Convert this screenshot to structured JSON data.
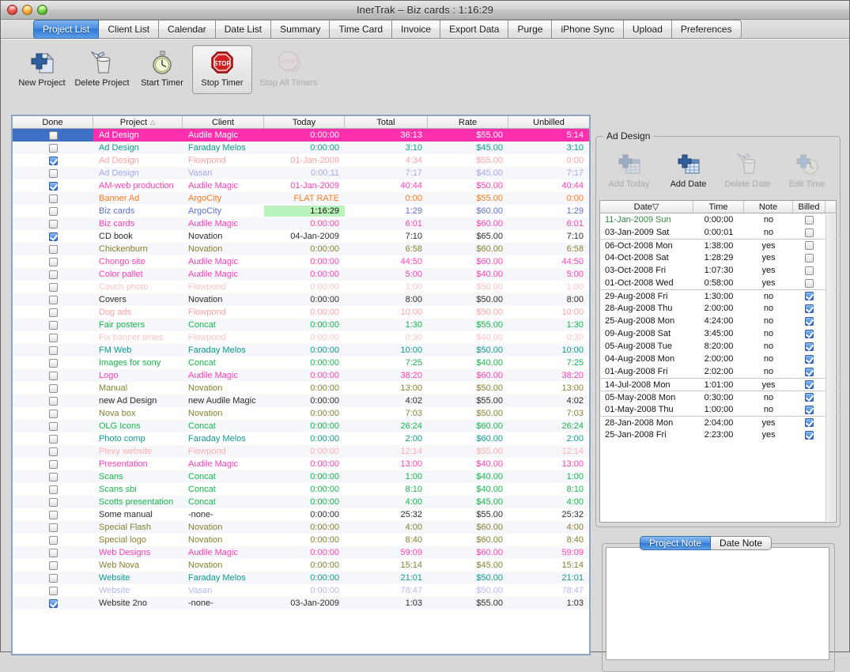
{
  "window": {
    "title": "InerTrak – Biz cards : 1:16:29"
  },
  "tabs": [
    {
      "label": "Project List",
      "active": true
    },
    {
      "label": "Client List",
      "active": false
    },
    {
      "label": "Calendar",
      "active": false
    },
    {
      "label": "Date List",
      "active": false
    },
    {
      "label": "Summary",
      "active": false
    },
    {
      "label": "Time Card",
      "active": false
    },
    {
      "label": "Invoice",
      "active": false
    },
    {
      "label": "Export Data",
      "active": false
    },
    {
      "label": "Purge",
      "active": false
    },
    {
      "label": "iPhone Sync",
      "active": false
    },
    {
      "label": "Upload",
      "active": false
    },
    {
      "label": "Preferences",
      "active": false
    }
  ],
  "toolbar": [
    {
      "label": "New Project",
      "icon": "new-document-plus-icon",
      "state": "normal"
    },
    {
      "label": "Delete Project",
      "icon": "trash-can-icon",
      "state": "normal"
    },
    {
      "label": "Start Timer",
      "icon": "stopwatch-icon",
      "state": "normal"
    },
    {
      "label": "Stop Timer",
      "icon": "stop-sign-icon",
      "state": "pressed"
    },
    {
      "label": "Stop All Timers",
      "icon": "stop-sign-stack-icon",
      "state": "disabled"
    }
  ],
  "project_table": {
    "columns": [
      "Done",
      "Project",
      "Client",
      "Today",
      "Total",
      "Rate",
      "Unbilled"
    ],
    "sorted_column": "Project",
    "sort_direction": "asc",
    "rows": [
      {
        "done": false,
        "selected": true,
        "project": "Ad Design",
        "client": "Audile Magic",
        "today": "0:00:00",
        "total": "36:13",
        "rate": "$55.00",
        "unbilled": "5:14",
        "color": "#ff2fae"
      },
      {
        "done": false,
        "selected": false,
        "project": "Ad Design",
        "client": "Faraday Melos",
        "today": "0:00:00",
        "total": "3:10",
        "rate": "$45.00",
        "unbilled": "3:10",
        "color": "#0e9b8e"
      },
      {
        "done": true,
        "selected": false,
        "project": "Ad Design",
        "client": "Flowpond",
        "today": "01-Jan-2009",
        "total": "4:34",
        "rate": "$55.00",
        "unbilled": "0:00",
        "color": "#ffa3a3"
      },
      {
        "done": false,
        "selected": false,
        "project": "Ad Design",
        "client": "Vasari",
        "today": "0:00:11",
        "total": "7:17",
        "rate": "$45.00",
        "unbilled": "7:17",
        "color": "#a5a8ee"
      },
      {
        "done": true,
        "selected": false,
        "project": "AM-web production",
        "client": "Audile Magic",
        "today": "01-Jan-2009",
        "total": "40:44",
        "rate": "$50.00",
        "unbilled": "40:44",
        "color": "#ff3fb4"
      },
      {
        "done": false,
        "selected": false,
        "project": "Banner Ad",
        "client": "ArgoCity",
        "today": "FLAT RATE",
        "total": "0:00",
        "rate": "$55.00",
        "unbilled": "0:00",
        "color": "#ff7a1f"
      },
      {
        "done": false,
        "selected": false,
        "project": "Biz cards",
        "client": "ArgoCity",
        "today": "1:16:29",
        "total": "1:29",
        "rate": "$60.00",
        "unbilled": "1:29",
        "color": "#5b6fd6",
        "today_highlight": true
      },
      {
        "done": false,
        "selected": false,
        "project": "Biz cards",
        "client": "Audile Magic",
        "today": "0:00:00",
        "total": "6:01",
        "rate": "$60.00",
        "unbilled": "6:01",
        "color": "#ff3fb4"
      },
      {
        "done": true,
        "selected": false,
        "project": "CD book",
        "client": "Novation",
        "today": "04-Jan-2009",
        "total": "7:10",
        "rate": "$65.00",
        "unbilled": "7:10",
        "color": "#2b2b2b"
      },
      {
        "done": false,
        "selected": false,
        "project": "Chickenburn",
        "client": "Novation",
        "today": "0:00:00",
        "total": "6:58",
        "rate": "$60.00",
        "unbilled": "6:58",
        "color": "#8a8030"
      },
      {
        "done": false,
        "selected": false,
        "project": "Chongo site",
        "client": "Audile Magic",
        "today": "0:00:00",
        "total": "44:50",
        "rate": "$60.00",
        "unbilled": "44:50",
        "color": "#ff3fb4"
      },
      {
        "done": false,
        "selected": false,
        "project": "Color pallet",
        "client": "Audile Magic",
        "today": "0:00:00",
        "total": "5:00",
        "rate": "$40.00",
        "unbilled": "5:00",
        "color": "#ff3fb4"
      },
      {
        "done": false,
        "selected": false,
        "project": "Couch photo",
        "client": "Flowpond",
        "today": "0:00:00",
        "total": "1:00",
        "rate": "$50.00",
        "unbilled": "1:00",
        "color": "#ffc3c3"
      },
      {
        "done": false,
        "selected": false,
        "project": "Covers",
        "client": "Novation",
        "today": "0:00:00",
        "total": "8:00",
        "rate": "$50.00",
        "unbilled": "8:00",
        "color": "#2b2b2b"
      },
      {
        "done": false,
        "selected": false,
        "project": "Dog ads",
        "client": "Flowpond",
        "today": "0:00:00",
        "total": "10:00",
        "rate": "$50.00",
        "unbilled": "10:00",
        "color": "#ffa3a3"
      },
      {
        "done": false,
        "selected": false,
        "project": "Fair posters",
        "client": "Concat",
        "today": "0:00:00",
        "total": "1:30",
        "rate": "$55.00",
        "unbilled": "1:30",
        "color": "#17b74a"
      },
      {
        "done": false,
        "selected": false,
        "project": "Fix banner times",
        "client": "Flowpond",
        "today": "0:00:00",
        "total": "0:30",
        "rate": "$40.00",
        "unbilled": "0:30",
        "color": "#ffc3c3"
      },
      {
        "done": false,
        "selected": false,
        "project": "FM Web",
        "client": "Faraday Melos",
        "today": "0:00:00",
        "total": "10:00",
        "rate": "$50.00",
        "unbilled": "10:00",
        "color": "#0e9b8e"
      },
      {
        "done": false,
        "selected": false,
        "project": "Images for sony",
        "client": "Concat",
        "today": "0:00:00",
        "total": "7:25",
        "rate": "$40.00",
        "unbilled": "7:25",
        "color": "#17b74a"
      },
      {
        "done": false,
        "selected": false,
        "project": "Logo",
        "client": "Audile Magic",
        "today": "0:00:00",
        "total": "38:20",
        "rate": "$60.00",
        "unbilled": "38:20",
        "color": "#ff3fb4"
      },
      {
        "done": false,
        "selected": false,
        "project": "Manual",
        "client": "Novation",
        "today": "0:00:00",
        "total": "13:00",
        "rate": "$50.00",
        "unbilled": "13:00",
        "color": "#8a8030"
      },
      {
        "done": false,
        "selected": false,
        "project": "new Ad Design",
        "client": "new Audile Magic",
        "today": "0:00:00",
        "total": "4:02",
        "rate": "$55.00",
        "unbilled": "4:02",
        "color": "#2b2b2b"
      },
      {
        "done": false,
        "selected": false,
        "project": "Nova box",
        "client": "Novation",
        "today": "0:00:00",
        "total": "7:03",
        "rate": "$50.00",
        "unbilled": "7:03",
        "color": "#8a8030"
      },
      {
        "done": false,
        "selected": false,
        "project": "OLG Icons",
        "client": "Concat",
        "today": "0:00:00",
        "total": "26:24",
        "rate": "$60.00",
        "unbilled": "26:24",
        "color": "#17b74a"
      },
      {
        "done": false,
        "selected": false,
        "project": "Photo comp",
        "client": "Faraday Melos",
        "today": "0:00:00",
        "total": "2:00",
        "rate": "$60.00",
        "unbilled": "2:00",
        "color": "#0e9b8e"
      },
      {
        "done": false,
        "selected": false,
        "project": "Plexy website",
        "client": "Flowpond",
        "today": "0:00:00",
        "total": "12:14",
        "rate": "$55.00",
        "unbilled": "12:14",
        "color": "#ffafaf"
      },
      {
        "done": false,
        "selected": false,
        "project": "Presentation",
        "client": "Audile Magic",
        "today": "0:00:00",
        "total": "13:00",
        "rate": "$40.00",
        "unbilled": "13:00",
        "color": "#ff3fb4"
      },
      {
        "done": false,
        "selected": false,
        "project": "Scans",
        "client": "Concat",
        "today": "0:00:00",
        "total": "1:00",
        "rate": "$40.00",
        "unbilled": "1:00",
        "color": "#17b74a"
      },
      {
        "done": false,
        "selected": false,
        "project": "Scans sbi",
        "client": "Concat",
        "today": "0:00:00",
        "total": "8:10",
        "rate": "$40.00",
        "unbilled": "8:10",
        "color": "#17b74a"
      },
      {
        "done": false,
        "selected": false,
        "project": "Scotts presentation",
        "client": "Concat",
        "today": "0:00:00",
        "total": "4:00",
        "rate": "$45.00",
        "unbilled": "4:00",
        "color": "#17b74a"
      },
      {
        "done": false,
        "selected": false,
        "project": "Some manual",
        "client": "-none-",
        "today": "0:00:00",
        "total": "25:32",
        "rate": "$55.00",
        "unbilled": "25:32",
        "color": "#2b2b2b"
      },
      {
        "done": false,
        "selected": false,
        "project": "Special Flash",
        "client": "Novation",
        "today": "0:00:00",
        "total": "4:00",
        "rate": "$60.00",
        "unbilled": "4:00",
        "color": "#8a8030"
      },
      {
        "done": false,
        "selected": false,
        "project": "Special logo",
        "client": "Novation",
        "today": "0:00:00",
        "total": "8:40",
        "rate": "$60.00",
        "unbilled": "8:40",
        "color": "#8a8030"
      },
      {
        "done": false,
        "selected": false,
        "project": "Web Designs",
        "client": "Audile Magic",
        "today": "0:00:00",
        "total": "59:09",
        "rate": "$60.00",
        "unbilled": "59:09",
        "color": "#ff3fb4"
      },
      {
        "done": false,
        "selected": false,
        "project": "Web Nova",
        "client": "Novation",
        "today": "0:00:00",
        "total": "15:14",
        "rate": "$45.00",
        "unbilled": "15:14",
        "color": "#8a8030"
      },
      {
        "done": false,
        "selected": false,
        "project": "Website",
        "client": "Faraday Melos",
        "today": "0:00:00",
        "total": "21:01",
        "rate": "$50.00",
        "unbilled": "21:01",
        "color": "#0e9b8e"
      },
      {
        "done": false,
        "selected": false,
        "project": "Website",
        "client": "Vasari",
        "today": "0:00:00",
        "total": "78:47",
        "rate": "$50.00",
        "unbilled": "78:47",
        "color": "#b5b8f0"
      },
      {
        "done": true,
        "selected": false,
        "project": "Website 2no",
        "client": "-none-",
        "today": "03-Jan-2009",
        "total": "1:03",
        "rate": "$55.00",
        "unbilled": "1:03",
        "color": "#2b2b2b"
      }
    ]
  },
  "detail_panel": {
    "title": "Ad Design",
    "buttons": [
      {
        "label": "Add Today",
        "icon": "add-today-icon",
        "state": "disabled"
      },
      {
        "label": "Add Date",
        "icon": "add-date-icon",
        "state": "normal"
      },
      {
        "label": "Delete Date",
        "icon": "delete-date-icon",
        "state": "disabled"
      },
      {
        "label": "Edit Time",
        "icon": "edit-time-icon",
        "state": "disabled"
      }
    ],
    "columns": [
      "Date",
      "Time",
      "Note",
      "Billed"
    ],
    "sorted_column": "Date",
    "sort_direction": "desc",
    "rows": [
      {
        "date": "11-Jan-2009 Sun",
        "time": "0:00:00",
        "note": "no",
        "billed": false,
        "today": true
      },
      {
        "date": "03-Jan-2009 Sat",
        "time": "0:00:01",
        "note": "no",
        "billed": false
      },
      {
        "date": "06-Oct-2008 Mon",
        "time": "1:38:00",
        "note": "yes",
        "billed": false,
        "group_start": true
      },
      {
        "date": "04-Oct-2008 Sat",
        "time": "1:28:29",
        "note": "yes",
        "billed": false
      },
      {
        "date": "03-Oct-2008 Fri",
        "time": "1:07:30",
        "note": "yes",
        "billed": false
      },
      {
        "date": "01-Oct-2008 Wed",
        "time": "0:58:00",
        "note": "yes",
        "billed": false
      },
      {
        "date": "29-Aug-2008 Fri",
        "time": "1:30:00",
        "note": "no",
        "billed": true,
        "group_start": true
      },
      {
        "date": "28-Aug-2008 Thu",
        "time": "2:00:00",
        "note": "no",
        "billed": true
      },
      {
        "date": "25-Aug-2008 Mon",
        "time": "4:24:00",
        "note": "no",
        "billed": true
      },
      {
        "date": "09-Aug-2008 Sat",
        "time": "3:45:00",
        "note": "no",
        "billed": true
      },
      {
        "date": "05-Aug-2008 Tue",
        "time": "8:20:00",
        "note": "no",
        "billed": true
      },
      {
        "date": "04-Aug-2008 Mon",
        "time": "2:00:00",
        "note": "no",
        "billed": true
      },
      {
        "date": "01-Aug-2008 Fri",
        "time": "2:02:00",
        "note": "no",
        "billed": true
      },
      {
        "date": "14-Jul-2008 Mon",
        "time": "1:01:00",
        "note": "yes",
        "billed": true,
        "group_start": true
      },
      {
        "date": "05-May-2008 Mon",
        "time": "0:30:00",
        "note": "no",
        "billed": true,
        "group_start": true
      },
      {
        "date": "01-May-2008 Thu",
        "time": "1:00:00",
        "note": "no",
        "billed": true
      },
      {
        "date": "28-Jan-2008 Mon",
        "time": "2:04:00",
        "note": "yes",
        "billed": true,
        "group_start": true
      },
      {
        "date": "25-Jan-2008 Fri",
        "time": "2:23:00",
        "note": "yes",
        "billed": true
      }
    ]
  },
  "note_panel": {
    "tabs": [
      {
        "label": "Project Note",
        "active": true
      },
      {
        "label": "Date Note",
        "active": false
      }
    ],
    "text": ""
  },
  "colors": {
    "selection_row": "#ff2fae",
    "selection_done_cell": "#3d6fc4",
    "running_timer_highlight": "#b9f3bb",
    "active_tab": "#2f79d6"
  }
}
